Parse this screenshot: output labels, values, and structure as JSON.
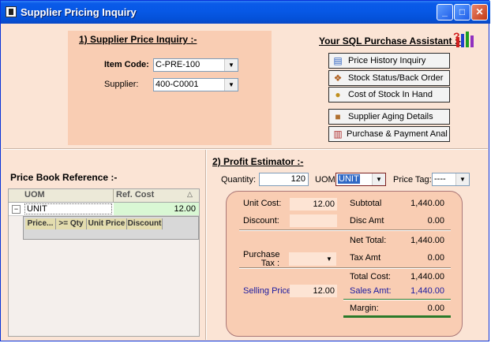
{
  "window": {
    "title": "Supplier Pricing Inquiry",
    "controls": {
      "minimize": "_",
      "maximize": "□",
      "close": "✕"
    }
  },
  "inquiry": {
    "heading": "1) Supplier Price Inquiry :-",
    "item_code_label": "Item Code:",
    "item_code_value": "C-PRE-100",
    "supplier_label": "Supplier:",
    "supplier_value": "400-C0001"
  },
  "assistant": {
    "heading": "Your SQL Purchase Assistant :-",
    "buttons": [
      {
        "label": "Price History Inquiry",
        "icon": "chart-icon"
      },
      {
        "label": "Stock Status/Back Order",
        "icon": "boxes-icon"
      },
      {
        "label": "Cost of Stock In Hand",
        "icon": "coins-icon"
      },
      {
        "label": "Supplier Aging Details",
        "icon": "truck-icon"
      },
      {
        "label": "Purchase & Payment Analysis",
        "icon": "bar-chart-icon"
      }
    ]
  },
  "price_book": {
    "heading": "Price Book Reference :-",
    "columns": [
      "UOM",
      "Ref. Cost"
    ],
    "rows": [
      {
        "uom": "UNIT",
        "ref_cost": "12.00"
      }
    ],
    "expander": "−",
    "sort_glyph": "△",
    "sub_columns": [
      "Price...",
      ">= Qty",
      "Unit Price",
      "Discount"
    ]
  },
  "estimator": {
    "heading": "2) Profit Estimator :-",
    "quantity_label": "Quantity:",
    "quantity_value": "120",
    "uom_label": "UOM:",
    "uom_value": "UNIT",
    "price_tag_label": "Price Tag:",
    "price_tag_value": "----",
    "unit_cost_label": "Unit Cost:",
    "unit_cost_value": "12.00",
    "discount_label": "Discount:",
    "discount_value": "",
    "purchase_tax_label_1": "Purchase",
    "purchase_tax_label_2": "Tax :",
    "purchase_tax_value": "",
    "selling_price_label": "Selling Price:",
    "selling_price_value": "12.00",
    "subtotal_label": "Subtotal",
    "subtotal_value": "1,440.00",
    "disc_amt_label": "Disc Amt",
    "disc_amt_value": "0.00",
    "net_total_label": "Net Total:",
    "net_total_value": "1,440.00",
    "tax_amt_label": "Tax Amt",
    "tax_amt_value": "0.00",
    "total_cost_label": "Total Cost:",
    "total_cost_value": "1,440.00",
    "sales_amt_label": "Sales Amt:",
    "sales_amt_value": "1,440.00",
    "margin_label": "Margin:",
    "margin_value": "0.00"
  },
  "colors": {
    "background": "#fbe4d5",
    "panel": "#f9cdb3",
    "titlebar": "#0758e6",
    "accent_blue": "#1a1aa0"
  }
}
